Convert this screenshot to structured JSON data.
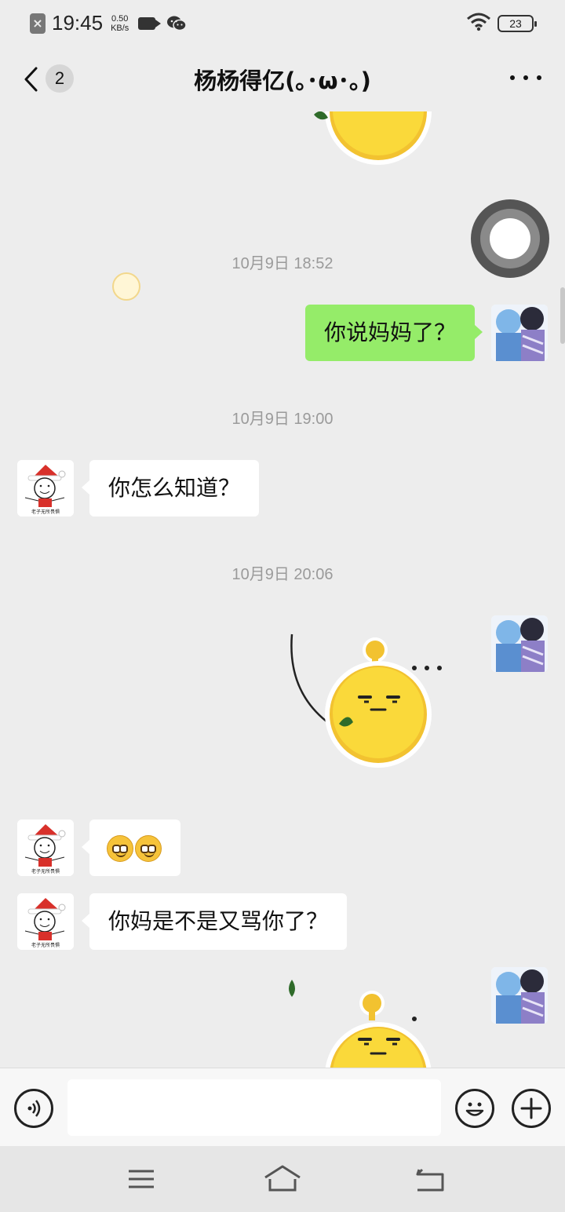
{
  "status_bar": {
    "time": "19:45",
    "speed_value": "0.50",
    "speed_unit": "KB/s",
    "battery": "23"
  },
  "header": {
    "unread_count": "2",
    "title": "杨杨得亿(｡･ω･｡)"
  },
  "messages": {
    "ts1": "10月9日 18:52",
    "m1": "你说妈妈了？",
    "ts2": "10月9日 19:00",
    "m2": "你怎么知道？",
    "ts3": "10月9日 20:06",
    "m4": "你妈是不是又骂你了？"
  },
  "avatar_caption": "老子无所畏惧",
  "icons": {
    "status_close": "close-icon",
    "camera": "video-camera-icon",
    "wechat": "wechat-icon",
    "wifi": "wifi-icon",
    "back": "chevron-left-icon",
    "more": "more-icon",
    "voice": "voice-icon",
    "emoji": "emoji-icon",
    "plus": "plus-icon",
    "menu": "menu-icon",
    "home": "home-icon",
    "return": "return-icon"
  },
  "colors": {
    "background": "#ededed",
    "outgoing_bubble": "#95ec69",
    "incoming_bubble": "#ffffff",
    "timestamp": "#9a9a9a",
    "sticker_yellow": "#f7d531"
  }
}
